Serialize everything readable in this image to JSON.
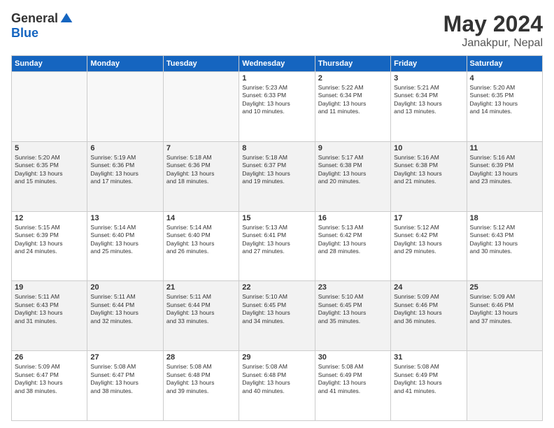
{
  "logo": {
    "general": "General",
    "blue": "Blue"
  },
  "title": "May 2024",
  "location": "Janakpur, Nepal",
  "days_header": [
    "Sunday",
    "Monday",
    "Tuesday",
    "Wednesday",
    "Thursday",
    "Friday",
    "Saturday"
  ],
  "weeks": [
    [
      {
        "day": "",
        "info": ""
      },
      {
        "day": "",
        "info": ""
      },
      {
        "day": "",
        "info": ""
      },
      {
        "day": "1",
        "info": "Sunrise: 5:23 AM\nSunset: 6:33 PM\nDaylight: 13 hours\nand 10 minutes."
      },
      {
        "day": "2",
        "info": "Sunrise: 5:22 AM\nSunset: 6:34 PM\nDaylight: 13 hours\nand 11 minutes."
      },
      {
        "day": "3",
        "info": "Sunrise: 5:21 AM\nSunset: 6:34 PM\nDaylight: 13 hours\nand 13 minutes."
      },
      {
        "day": "4",
        "info": "Sunrise: 5:20 AM\nSunset: 6:35 PM\nDaylight: 13 hours\nand 14 minutes."
      }
    ],
    [
      {
        "day": "5",
        "info": "Sunrise: 5:20 AM\nSunset: 6:35 PM\nDaylight: 13 hours\nand 15 minutes."
      },
      {
        "day": "6",
        "info": "Sunrise: 5:19 AM\nSunset: 6:36 PM\nDaylight: 13 hours\nand 17 minutes."
      },
      {
        "day": "7",
        "info": "Sunrise: 5:18 AM\nSunset: 6:36 PM\nDaylight: 13 hours\nand 18 minutes."
      },
      {
        "day": "8",
        "info": "Sunrise: 5:18 AM\nSunset: 6:37 PM\nDaylight: 13 hours\nand 19 minutes."
      },
      {
        "day": "9",
        "info": "Sunrise: 5:17 AM\nSunset: 6:38 PM\nDaylight: 13 hours\nand 20 minutes."
      },
      {
        "day": "10",
        "info": "Sunrise: 5:16 AM\nSunset: 6:38 PM\nDaylight: 13 hours\nand 21 minutes."
      },
      {
        "day": "11",
        "info": "Sunrise: 5:16 AM\nSunset: 6:39 PM\nDaylight: 13 hours\nand 23 minutes."
      }
    ],
    [
      {
        "day": "12",
        "info": "Sunrise: 5:15 AM\nSunset: 6:39 PM\nDaylight: 13 hours\nand 24 minutes."
      },
      {
        "day": "13",
        "info": "Sunrise: 5:14 AM\nSunset: 6:40 PM\nDaylight: 13 hours\nand 25 minutes."
      },
      {
        "day": "14",
        "info": "Sunrise: 5:14 AM\nSunset: 6:40 PM\nDaylight: 13 hours\nand 26 minutes."
      },
      {
        "day": "15",
        "info": "Sunrise: 5:13 AM\nSunset: 6:41 PM\nDaylight: 13 hours\nand 27 minutes."
      },
      {
        "day": "16",
        "info": "Sunrise: 5:13 AM\nSunset: 6:42 PM\nDaylight: 13 hours\nand 28 minutes."
      },
      {
        "day": "17",
        "info": "Sunrise: 5:12 AM\nSunset: 6:42 PM\nDaylight: 13 hours\nand 29 minutes."
      },
      {
        "day": "18",
        "info": "Sunrise: 5:12 AM\nSunset: 6:43 PM\nDaylight: 13 hours\nand 30 minutes."
      }
    ],
    [
      {
        "day": "19",
        "info": "Sunrise: 5:11 AM\nSunset: 6:43 PM\nDaylight: 13 hours\nand 31 minutes."
      },
      {
        "day": "20",
        "info": "Sunrise: 5:11 AM\nSunset: 6:44 PM\nDaylight: 13 hours\nand 32 minutes."
      },
      {
        "day": "21",
        "info": "Sunrise: 5:11 AM\nSunset: 6:44 PM\nDaylight: 13 hours\nand 33 minutes."
      },
      {
        "day": "22",
        "info": "Sunrise: 5:10 AM\nSunset: 6:45 PM\nDaylight: 13 hours\nand 34 minutes."
      },
      {
        "day": "23",
        "info": "Sunrise: 5:10 AM\nSunset: 6:45 PM\nDaylight: 13 hours\nand 35 minutes."
      },
      {
        "day": "24",
        "info": "Sunrise: 5:09 AM\nSunset: 6:46 PM\nDaylight: 13 hours\nand 36 minutes."
      },
      {
        "day": "25",
        "info": "Sunrise: 5:09 AM\nSunset: 6:46 PM\nDaylight: 13 hours\nand 37 minutes."
      }
    ],
    [
      {
        "day": "26",
        "info": "Sunrise: 5:09 AM\nSunset: 6:47 PM\nDaylight: 13 hours\nand 38 minutes."
      },
      {
        "day": "27",
        "info": "Sunrise: 5:08 AM\nSunset: 6:47 PM\nDaylight: 13 hours\nand 38 minutes."
      },
      {
        "day": "28",
        "info": "Sunrise: 5:08 AM\nSunset: 6:48 PM\nDaylight: 13 hours\nand 39 minutes."
      },
      {
        "day": "29",
        "info": "Sunrise: 5:08 AM\nSunset: 6:48 PM\nDaylight: 13 hours\nand 40 minutes."
      },
      {
        "day": "30",
        "info": "Sunrise: 5:08 AM\nSunset: 6:49 PM\nDaylight: 13 hours\nand 41 minutes."
      },
      {
        "day": "31",
        "info": "Sunrise: 5:08 AM\nSunset: 6:49 PM\nDaylight: 13 hours\nand 41 minutes."
      },
      {
        "day": "",
        "info": ""
      }
    ]
  ]
}
